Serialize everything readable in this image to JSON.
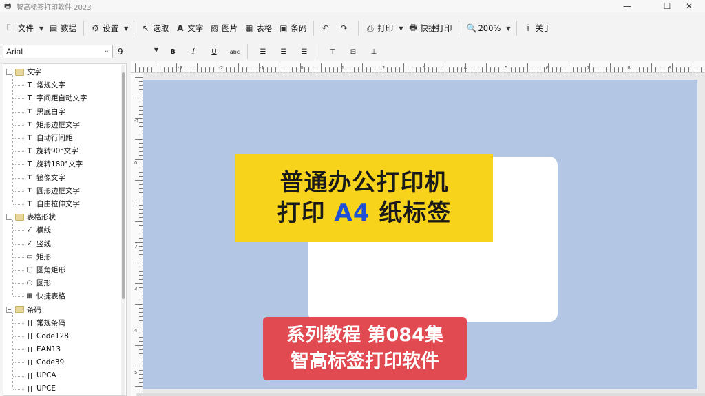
{
  "window": {
    "title": "智高标签打印软件 2023",
    "controls": {
      "minimize": "—",
      "maximize": "☐",
      "close": "✕"
    }
  },
  "toolbar": {
    "file": "文件",
    "data": "数据",
    "settings": "设置",
    "select": "选取",
    "text": "文字",
    "image": "图片",
    "table": "表格",
    "barcode": "条码",
    "print": "打印",
    "quick_print": "快捷打印",
    "zoom": "200%",
    "about": "关于"
  },
  "format_bar": {
    "font_family": "Arial",
    "font_size": "9",
    "bold": "B",
    "italic": "I",
    "underline": "U",
    "strike": "abc"
  },
  "tree": {
    "groups": [
      {
        "label": "文字",
        "items": [
          "常规文字",
          "字间距自动文字",
          "黑底白字",
          "矩形边框文字",
          "自动行间距",
          "旋转90°文字",
          "旋转180°文字",
          "镜像文字",
          "圆形边框文字",
          "自由拉伸文字"
        ]
      },
      {
        "label": "表格形状",
        "items": [
          "横线",
          "竖线",
          "矩形",
          "圆角矩形",
          "圆形",
          "快捷表格"
        ]
      },
      {
        "label": "条码",
        "items": [
          "常规条码",
          "Code128",
          "EAN13",
          "Code39",
          "UPCA",
          "UPCE"
        ]
      }
    ]
  },
  "ruler": {
    "top_labels": [
      "-3",
      "-2",
      "-1",
      "0",
      "1",
      "2",
      "3",
      "4",
      "5",
      "6",
      "7",
      "8",
      "9"
    ],
    "left_labels": [
      "-1",
      "0",
      "1",
      "2",
      "3",
      "4",
      "5"
    ]
  },
  "overlay": {
    "yellow_line1": "普通办公打印机",
    "yellow_line2_pre": "打印 ",
    "yellow_line2_a4": "A4",
    "yellow_line2_post": " 纸标签",
    "red_line1": "系列教程 第084集",
    "red_line2": "智高标签打印软件"
  },
  "colors": {
    "paper_bg": "#b3c6e3",
    "banner_yellow": "#f7d31c",
    "banner_red": "#e24a52",
    "a4_blue": "#1e4fd6"
  }
}
